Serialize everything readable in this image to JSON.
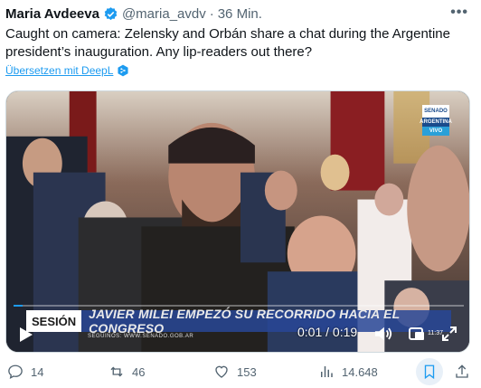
{
  "author": {
    "name": "Maria Avdeeva",
    "handle": "@maria_avdv",
    "separator": "·",
    "time": "36 Min."
  },
  "tweet": {
    "text": "Caught on camera: Zelensky and Orbán share a chat during the Argentine president’s inauguration. Any lip-readers out there?",
    "translate_label": "Übersetzen mit DeepL"
  },
  "video": {
    "badge": {
      "top": "SENADO",
      "mid": "ARGENTINA",
      "live": "VIVO"
    },
    "lower_third_label": "SESIÓN",
    "lower_third_headline": "JAVIER MILEI EMPEZÓ SU RECORRIDO HACIA EL CONGRESO",
    "lower_third_sub": "SEGUINOS: WWW.SENADO.GOB.AR",
    "timecode": "0:01 / 0:19",
    "clock": "11:37",
    "progress": 0.02
  },
  "actions": {
    "replies": "14",
    "reposts": "46",
    "likes": "153",
    "views": "14.648"
  },
  "colors": {
    "accent": "#1d9bf0",
    "muted": "#536471",
    "verified": "#1d9bf0"
  },
  "icons": [
    "verified-badge-icon",
    "more-icon",
    "deepl-icon",
    "play-icon",
    "volume-icon",
    "gif-icon",
    "fullscreen-icon",
    "reply-icon",
    "repost-icon",
    "like-icon",
    "views-icon",
    "bookmark-icon",
    "share-icon"
  ]
}
